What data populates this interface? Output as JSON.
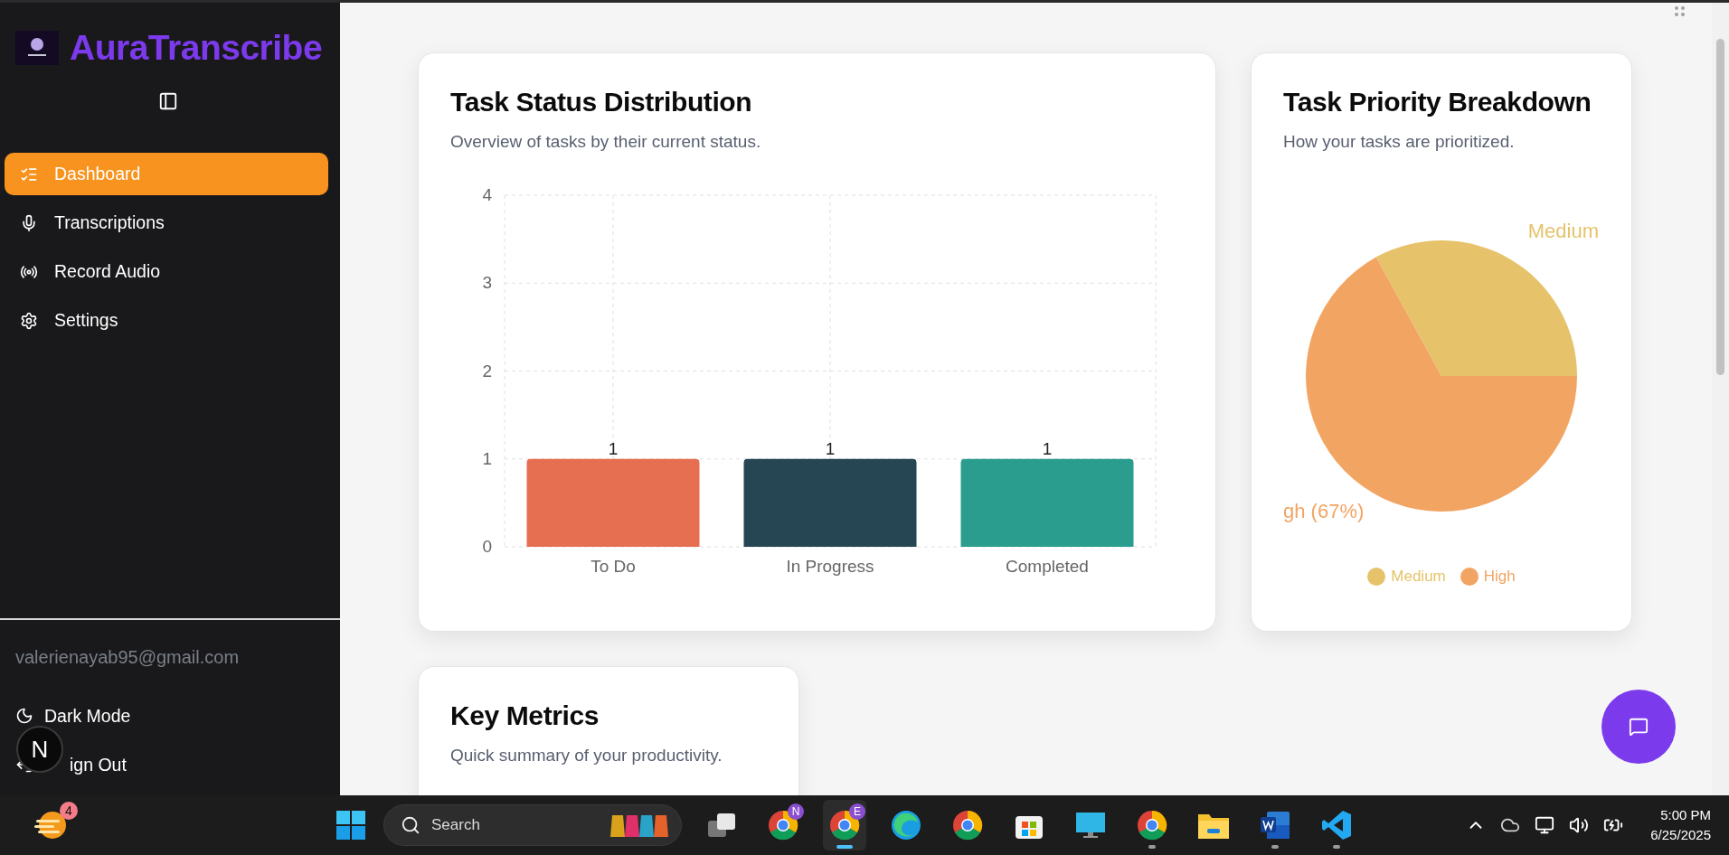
{
  "sidebar": {
    "brand": "AuraTranscribe",
    "items": [
      {
        "label": "Dashboard",
        "kind": "dashboard",
        "selected": true
      },
      {
        "label": "Transcriptions",
        "kind": "mic",
        "selected": false
      },
      {
        "label": "Record Audio",
        "kind": "record",
        "selected": false
      },
      {
        "label": "Settings",
        "kind": "settings",
        "selected": false
      }
    ],
    "email": "valerienayab95@gmail.com",
    "footer": [
      {
        "label": "Dark Mode",
        "kind": "theme"
      },
      {
        "label": "ign Out",
        "kind": "signout"
      }
    ]
  },
  "dev_badge": "N",
  "cards": [
    {
      "kind": "bar",
      "title": "Task Status Distribution",
      "subtitle": "Overview of tasks by their current status.",
      "chart_data": {
        "type": "bar",
        "categories": [
          "To Do",
          "In Progress",
          "Completed"
        ],
        "series": [
          {
            "values": [
              1,
              1,
              1
            ]
          }
        ],
        "colors": [
          "#e76f51",
          "#264653",
          "#2a9d8f"
        ],
        "ylim": [
          0,
          4
        ],
        "yticks": [
          0,
          1,
          2,
          3,
          4
        ],
        "grid": true,
        "data_labels": true
      }
    },
    {
      "kind": "pie",
      "title": "Task Priority Breakdown",
      "subtitle": "How your tasks are prioritized.",
      "chart_data": {
        "type": "pie",
        "categories": [
          "Medium",
          "High"
        ],
        "series": [
          {
            "values": [
              33,
              67
            ]
          }
        ],
        "colors": [
          "#e6c36a",
          "#f2a462"
        ]
      },
      "slice_labels": [
        "Medium",
        "gh (67%)"
      ]
    },
    {
      "kind": "text",
      "title": "Key Metrics",
      "subtitle": "Quick summary of your productivity."
    }
  ],
  "taskbar": {
    "weather_badge": "4",
    "search_placeholder": "Search",
    "apps": [
      {
        "kind": "taskview",
        "selected": false,
        "running": false
      },
      {
        "kind": "chrome",
        "badge": "N",
        "selected": false,
        "running": false
      },
      {
        "kind": "chrome",
        "badge": "E",
        "selected": true,
        "running": true
      },
      {
        "kind": "edge",
        "selected": false,
        "running": false
      },
      {
        "kind": "chrome",
        "selected": false,
        "running": false
      },
      {
        "kind": "store",
        "selected": false,
        "running": false
      },
      {
        "kind": "monitor",
        "selected": false,
        "running": false
      },
      {
        "kind": "chrome",
        "selected": false,
        "running": true
      },
      {
        "kind": "folder",
        "selected": false,
        "running": false
      },
      {
        "kind": "word",
        "selected": false,
        "running": true
      },
      {
        "kind": "vscode",
        "selected": false,
        "running": true
      }
    ],
    "time": "5:00 PM",
    "date": "6/25/2025"
  }
}
